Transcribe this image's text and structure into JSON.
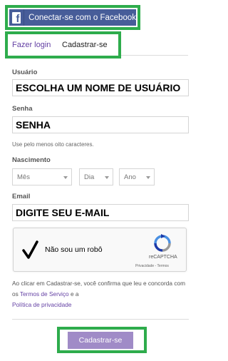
{
  "facebook": {
    "label": "Conectar-se com o Facebook",
    "icon": "facebook-icon"
  },
  "tabs": {
    "login": "Fazer login",
    "signup": "Cadastrar-se"
  },
  "fields": {
    "username": {
      "label": "Usuário",
      "value": "ESCOLHA UM NOME DE USUÁRIO"
    },
    "password": {
      "label": "Senha",
      "value": "SENHA",
      "hint": "Use pelo menos oito caracteres."
    },
    "birth": {
      "label": "Nascimento",
      "month": "Mês",
      "day": "Dia",
      "year": "Ano"
    },
    "email": {
      "label": "Email",
      "value": "DIGITE SEU E-MAIL"
    }
  },
  "captcha": {
    "label": "Não sou um robô",
    "brand": "reCAPTCHA",
    "privacy": "Privacidade",
    "separator": " - ",
    "terms": "Termos"
  },
  "terms": {
    "prefix": "Ao clicar em Cadastrar-se, você confirma que leu e concorda com os ",
    "tos_link": "Termos de Serviço",
    "middle": " e a ",
    "privacy_link": "Política de privacidade"
  },
  "submit": {
    "label": "Cadastrar-se"
  },
  "colors": {
    "highlight": "#2eac4c",
    "facebook": "#475d99",
    "brand_link": "#6441a4",
    "submit": "#a08bc7"
  }
}
